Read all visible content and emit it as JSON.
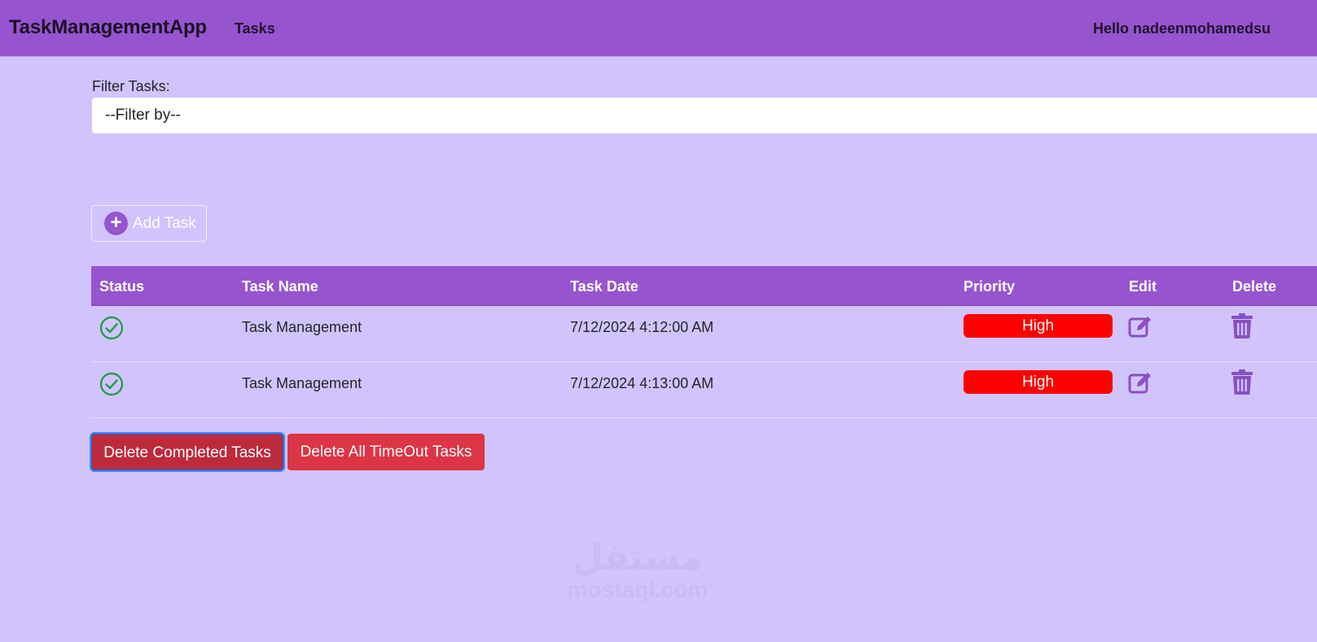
{
  "navbar": {
    "brand": "TaskManagementApp",
    "tasks_link": "Tasks",
    "greeting": "Hello nadeenmohamedsu"
  },
  "filter": {
    "label": "Filter Tasks:",
    "selected": "--Filter by--"
  },
  "add_button": {
    "label": "Add Task",
    "icon": "plus-circle-icon"
  },
  "table": {
    "columns": [
      "Status",
      "Task Name",
      "Task Date",
      "Priority",
      "Edit",
      "Delete"
    ],
    "rows": [
      {
        "status_icon": "check-circle-icon",
        "name": "Task Management",
        "date": "7/12/2024 4:12:00 AM",
        "priority": "High"
      },
      {
        "status_icon": "check-circle-icon",
        "name": "Task Management",
        "date": "7/12/2024 4:13:00 AM",
        "priority": "High"
      }
    ]
  },
  "actions": {
    "delete_completed": "Delete Completed Tasks",
    "delete_timeout": "Delete All TimeOut Tasks"
  },
  "watermark": {
    "arabic": "مستقل",
    "latin": "mostaql.com"
  },
  "colors": {
    "navbar": "#9754cf",
    "background": "#d1c4fc",
    "priority_high": "#ff0000",
    "danger": "#dc3545",
    "status_check": "#2e9a4f"
  }
}
